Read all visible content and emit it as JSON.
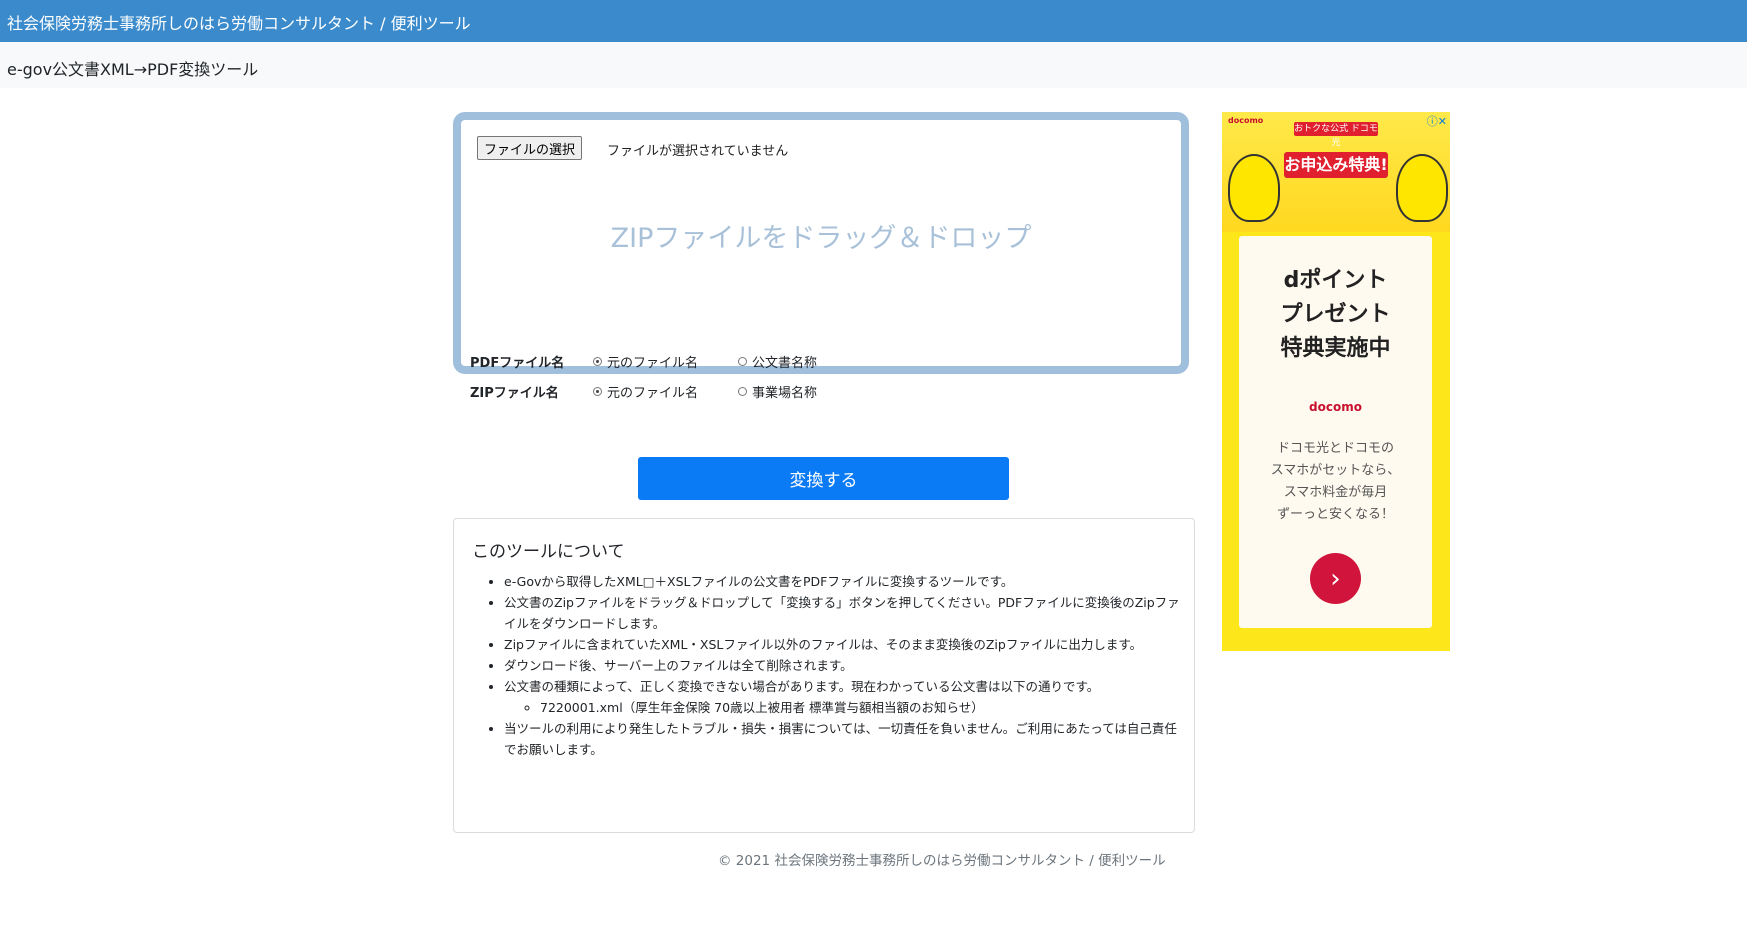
{
  "header": {
    "brand": "社会保険労務士事務所しのはら労働コンサルタント / 便利ツール"
  },
  "subheader": {
    "title": "e-gov公文書XML→PDF変換ツール"
  },
  "dropzone": {
    "file_button": "ファイルの選択",
    "file_status": "ファイルが選択されていません",
    "hint": "ZIPファイルをドラッグ＆ドロップ"
  },
  "options": {
    "pdf": {
      "label": "PDFファイル名",
      "choices": [
        "元のファイル名",
        "公文書名称"
      ],
      "selected": 0
    },
    "zip": {
      "label": "ZIPファイル名",
      "choices": [
        "元のファイル名",
        "事業場名称"
      ],
      "selected": 0
    }
  },
  "convert_button": "変換する",
  "about": {
    "title": "このツールについて",
    "items": [
      "e-Govから取得したXML□＋XSLファイルの公文書をPDFファイルに変換するツールです。",
      "公文書のZipファイルをドラッグ＆ドロップして「変換する」ボタンを押してください。PDFファイルに変換後のZipファイルをダウンロードします。",
      "Zipファイルに含まれていたXML・XSLファイル以外のファイルは、そのまま変換後のZipファイルに出力します。",
      "ダウンロード後、サーバー上のファイルは全て削除されます。",
      "公文書の種類によって、正しく変換できない場合があります。現在わかっている公文書は以下の通りです。",
      "当ツールの利用により発生したトラブル・損失・損害については、一切責任を負いません。ご利用にあたっては自己責任でお願いします。"
    ],
    "subitem": "7220001.xml（厚生年金保険 70歳以上被用者 標準賞与額相当額のお知らせ）"
  },
  "footer": "© 2021 社会保険労務士事務所しのはら労働コンサルタント / 便利ツール",
  "ad": {
    "brand_small": "docomo",
    "close": "ⓘ✕",
    "banner_top": "おトクな公式 ドコモ光",
    "banner_main": "お申込み特典!",
    "headline": "dポイント\nプレゼント\n特典実施中",
    "docomo": "docomo",
    "body": "ドコモ光とドコモの\nスマホがセットなら、\nスマホ料金が毎月\nずーっと安くなる！",
    "arrow": "›"
  }
}
